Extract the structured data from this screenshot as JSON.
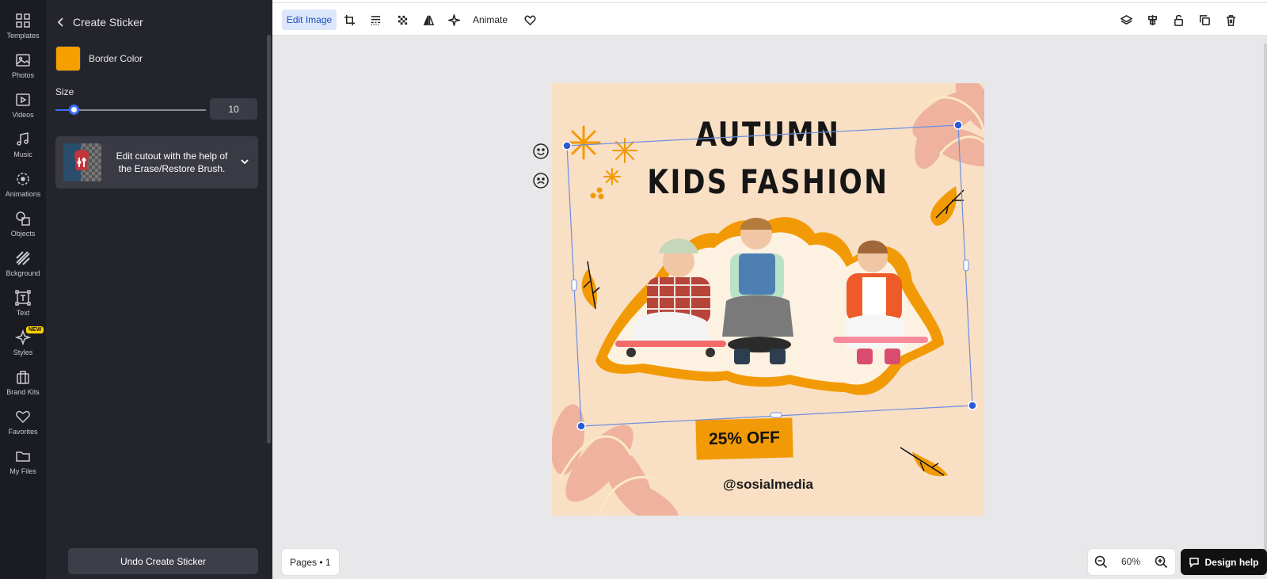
{
  "rail": {
    "items": [
      {
        "label": "Templates",
        "icon": "grid-icon"
      },
      {
        "label": "Photos",
        "icon": "image-icon"
      },
      {
        "label": "Videos",
        "icon": "play-icon"
      },
      {
        "label": "Music",
        "icon": "music-note-icon"
      },
      {
        "label": "Animations",
        "icon": "animation-icon"
      },
      {
        "label": "Objects",
        "icon": "shapes-icon"
      },
      {
        "label": "Bckground",
        "icon": "background-stripes-icon"
      },
      {
        "label": "Text",
        "icon": "text-box-icon"
      },
      {
        "label": "Styles",
        "icon": "sparkle-icon",
        "badge": "NEW"
      },
      {
        "label": "Brand Kits",
        "icon": "briefcase-icon"
      },
      {
        "label": "Favorites",
        "icon": "heart-icon"
      },
      {
        "label": "My Files",
        "icon": "folder-icon"
      }
    ]
  },
  "panel": {
    "title": "Create Sticker",
    "border_color_label": "Border Color",
    "border_color": "#f5a000",
    "size_label": "Size",
    "size_value": "10",
    "size_fraction": 0.12,
    "cutout_text": "Edit cutout with the help of the Erase/Restore Brush.",
    "undo_label": "Undo Create Sticker"
  },
  "toolbar": {
    "edit_image_label": "Edit Image",
    "animate_label": "Animate",
    "tools": [
      "crop-icon",
      "adjust-lines-icon",
      "transparency-checker-icon",
      "flip-icon",
      "magic-sparkle-icon",
      "heart-outline-icon"
    ],
    "right_tools": [
      "layers-icon",
      "align-icon",
      "unlock-icon",
      "duplicate-icon",
      "trash-icon"
    ]
  },
  "canvas": {
    "title_line1": "AUTUMN",
    "title_line2": "KIDS FASHION",
    "discount": "25% OFF",
    "handle": "@sosialmedia",
    "accent_color": "#f29a05",
    "background_color": "#f9dfc4"
  },
  "footer": {
    "pages_label": "Pages • 1",
    "zoom_value": "60%",
    "design_help_label": "Design help"
  }
}
